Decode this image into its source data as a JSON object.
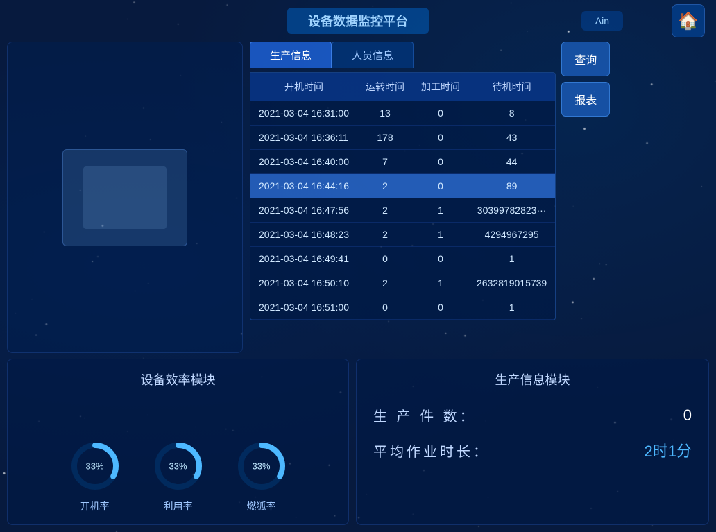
{
  "header": {
    "title": "设备数据监控平台",
    "right_info": "Ain",
    "home_icon": "🏠"
  },
  "tabs": [
    {
      "label": "生产信息",
      "active": true
    },
    {
      "label": "人员信息",
      "active": false
    }
  ],
  "table": {
    "headers": [
      "开机时间",
      "运转时间",
      "加工时间",
      "待机时间"
    ],
    "rows": [
      {
        "time": "2021-03-04 16:31:00",
        "run": "13",
        "process": "0",
        "standby": "8",
        "highlighted": false
      },
      {
        "time": "2021-03-04 16:36:11",
        "run": "178",
        "process": "0",
        "standby": "43",
        "highlighted": false
      },
      {
        "time": "2021-03-04 16:40:00",
        "run": "7",
        "process": "0",
        "standby": "44",
        "highlighted": false
      },
      {
        "time": "2021-03-04 16:44:16",
        "run": "2",
        "process": "0",
        "standby": "89",
        "highlighted": true
      },
      {
        "time": "2021-03-04 16:47:56",
        "run": "2",
        "process": "1",
        "standby": "30399782823···",
        "highlighted": false
      },
      {
        "time": "2021-03-04 16:48:23",
        "run": "2",
        "process": "1",
        "standby": "4294967295",
        "highlighted": false
      },
      {
        "time": "2021-03-04 16:49:41",
        "run": "0",
        "process": "0",
        "standby": "1",
        "highlighted": false
      },
      {
        "time": "2021-03-04 16:50:10",
        "run": "2",
        "process": "1",
        "standby": "2632819015739",
        "highlighted": false
      },
      {
        "time": "2021-03-04 16:51:00",
        "run": "0",
        "process": "0",
        "standby": "1",
        "highlighted": false
      }
    ]
  },
  "action_buttons": [
    {
      "label": "查询"
    },
    {
      "label": "报表"
    }
  ],
  "efficiency_module": {
    "title": "设备效率模块",
    "gauges": [
      {
        "name": "开机率",
        "value": "33%",
        "percent": 33
      },
      {
        "name": "利用率",
        "value": "33%",
        "percent": 33
      },
      {
        "name": "燃狐率",
        "value": "33%",
        "percent": 33
      }
    ]
  },
  "production_module": {
    "title": "生产信息模块",
    "items": [
      {
        "label": "生 产 件 数：",
        "value": "0",
        "highlight": false
      },
      {
        "label": "平均作业时长：",
        "value": "2时1分",
        "highlight": true
      }
    ]
  }
}
